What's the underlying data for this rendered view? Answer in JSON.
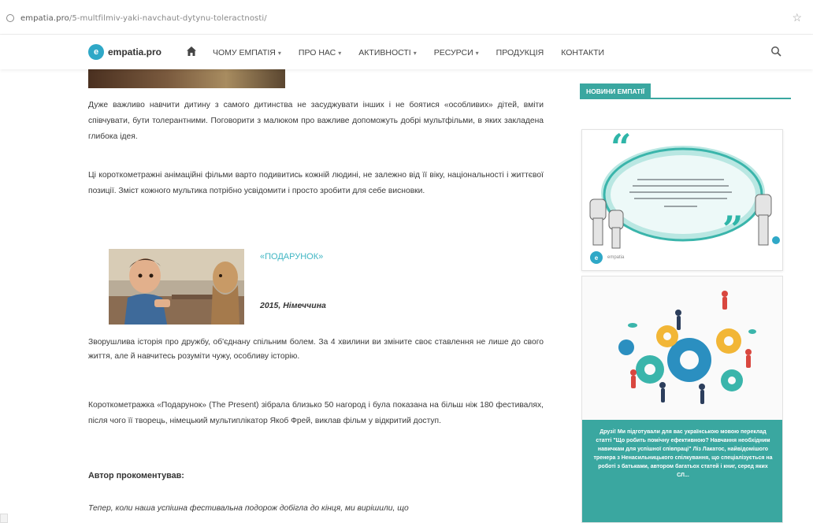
{
  "browser": {
    "url_host": "empatia.pro",
    "url_path": "/5-multfilmiv-yaki-navchaut-dytynu-toleractnosti/"
  },
  "nav": {
    "logo_text": "empatia.pro",
    "logo_mark": "e",
    "items": [
      {
        "label": "ЧОМУ ЕМПАТІЯ",
        "has_dropdown": true
      },
      {
        "label": "ПРО НАС",
        "has_dropdown": true
      },
      {
        "label": "АКТИВНОСТІ",
        "has_dropdown": true
      },
      {
        "label": "РЕСУРСИ",
        "has_dropdown": true
      },
      {
        "label": "ПРОДУКЦІЯ",
        "has_dropdown": false
      },
      {
        "label": "КОНТАКТИ",
        "has_dropdown": false
      }
    ],
    "caret": "▾",
    "icons": [
      "home-icon",
      "search-icon"
    ]
  },
  "article": {
    "p1": "Дуже важливо навчити дитину з самого дитинства не засуджувати інших і не боятися «особливих» дітей, вміти співчувати, бути толерантними. Поговорити з малюком про важливе допоможуть добрі мультфільми, в яких закладена глибока ідея.",
    "p2": "Ці короткометражні анімаційні фільми варто подивитись кожній людині, не залежно від її віку, національності і життєвої позиції. Зміст кожного мультика потрібно усвідомити і просто зробити для себе висновки.",
    "film_title": "«ПОДАРУНОК»",
    "film_meta": "2015, Німеччина",
    "p3": "Зворушлива історія про дружбу, об'єднану спільним болем. За 4 хвилини ви зміните своє ставлення не лише до свого життя, але й навчитесь розуміти чужу, особливу історію.",
    "p4": "Короткометражка «Подарунок» (The Present) зібрала близько 50 нагород і була показана на більш ніж 180 фестивалях, після чого її творець, німецький мультиплікатор Якоб Фрей, виклав фільм у відкритий доступ.",
    "author_heading": "Автор прокоментував:",
    "p5": "Тепер, коли наша успішна фестивальна подорож добігла до кінця, ми вирішили, що"
  },
  "sidebar": {
    "header": "НОВИНИ ЕМПАТІЇ",
    "card1_label": "empatia",
    "card2_text": "Друзі! Ми підготували для вас українською мовою переклад статті \"Що робить помічну ефективною? Навчання необхідним навичкам для успішної співпраці\" Ліз Лакатос, найвідомішого тренера з Ненасильницького спілкування, що спеціалізується на роботі з батьками, автором багатьох статей і книг, серед яких СЛ..."
  },
  "colors": {
    "accent": "#3aa7a0",
    "link": "#3fb6c3",
    "logo": "#2fa8c7"
  }
}
